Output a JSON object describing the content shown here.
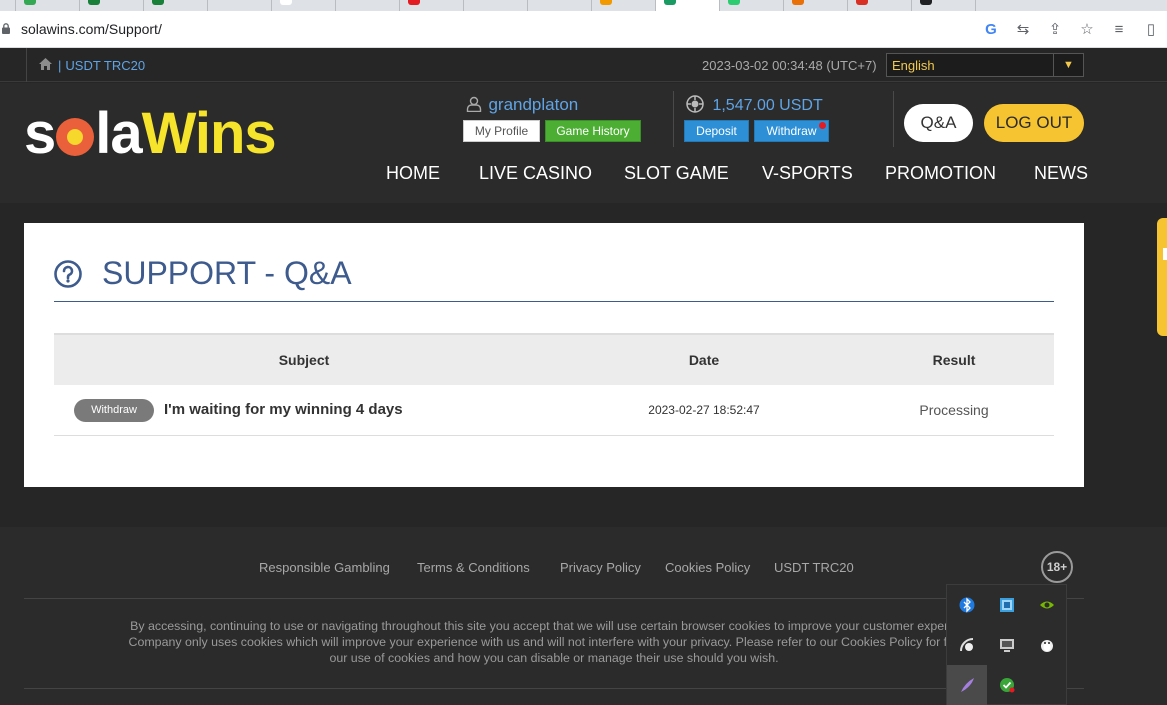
{
  "browser": {
    "url": "solawins.com/Support/",
    "tab_count": 15
  },
  "topbar": {
    "currency": "USDT TRC20",
    "separator": "|",
    "datetime": "2023-03-02 00:34:48 (UTC+7)",
    "language": "English"
  },
  "logo": {
    "part1": "s",
    "part2": "la",
    "part3": "Wins"
  },
  "user": {
    "username": "grandplaton",
    "my_profile": "My Profile",
    "game_history": "Game History"
  },
  "wallet": {
    "balance": "1,547.00 USDT",
    "deposit": "Deposit",
    "withdraw": "Withdraw"
  },
  "header_buttons": {
    "qa": "Q&A",
    "logout": "LOG OUT"
  },
  "nav": [
    {
      "label": "HOME"
    },
    {
      "label": "LIVE CASINO"
    },
    {
      "label": "SLOT GAME"
    },
    {
      "label": "V-SPORTS"
    },
    {
      "label": "PROMOTION"
    },
    {
      "label": "NEWS"
    }
  ],
  "support": {
    "title": "SUPPORT - Q&A",
    "columns": {
      "subject": "Subject",
      "date": "Date",
      "result": "Result"
    },
    "rows": [
      {
        "category": "Withdraw",
        "subject": "I'm waiting for my winning 4 days",
        "date": "2023-02-27 18:52:47",
        "result": "Processing"
      }
    ]
  },
  "footer": {
    "links": [
      {
        "label": "Responsible Gambling"
      },
      {
        "label": "Terms & Conditions"
      },
      {
        "label": "Privacy Policy"
      },
      {
        "label": "Cookies Policy"
      },
      {
        "label": "USDT TRC20"
      }
    ],
    "age_badge": "18+",
    "disclaimer_line1": "By accessing, continuing to use or navigating throughout this site you accept that we will use certain browser cookies to improve your customer experience",
    "disclaimer_line2": "Company only uses cookies which will improve your experience with us and will not interfere with your privacy. Please refer to our Cookies Policy for further",
    "disclaimer_line3": "our use of cookies and how you can disable or manage their use should you wish."
  },
  "tray_icons": [
    "bluetooth-icon",
    "network-app-icon",
    "nvidia-icon",
    "satellite-icon",
    "display-icon",
    "tux-icon",
    "feather-icon",
    "security-check-icon"
  ],
  "colors": {
    "accent_blue": "#5fa4e6",
    "brand_yellow": "#f6c431",
    "title_blue": "#3e5b8e",
    "green": "#4caf34"
  }
}
